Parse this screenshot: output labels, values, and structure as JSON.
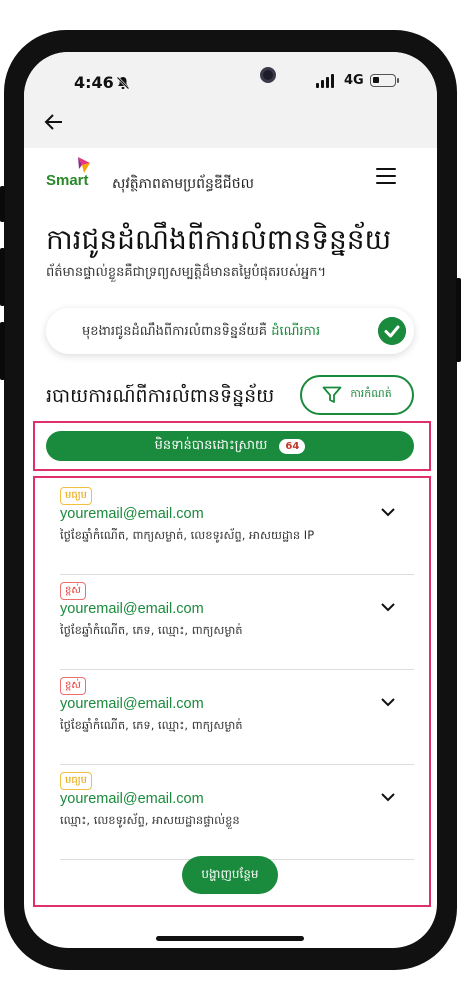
{
  "status_bar": {
    "time": "4:46",
    "network": "4G"
  },
  "header": {
    "logo_text": "Smart",
    "tagline": "សុវត្ថិភាពតាមប្រព័ន្ធឌីជីថល"
  },
  "page": {
    "title": "ការជូនដំណឹងពីការលំពានទិន្នន័យ",
    "subtitle": "ព័ត៌មានផ្ទាល់ខ្លួនគឺជាទ្រព្យសម្បត្តិដ៏មានតម្លៃបំផុតរបស់អ្នក។"
  },
  "status_card": {
    "text": "មុខងារជូនដំណឹងពីការលំពានទិន្នន័យគឺ",
    "status": "ដំណើរការ"
  },
  "breaches": {
    "title": "របាយការណ៍ពីការលំពានទិន្នន័យ",
    "filter_label": "ការកំណត់",
    "tab_label": "មិនទាន់បានដោះស្រាយ",
    "tab_count": "64",
    "items": [
      {
        "risk": "មធ្យម",
        "email": "youremail@email.com",
        "details": "ថ្ងៃខែឆ្នាំកំណើត, ពាក្យសម្ងាត់, លេខទូរស័ព្ទ, អាសយដ្ឋាន IP"
      },
      {
        "risk": "ខ្ពស់",
        "email": "youremail@email.com",
        "details": "ថ្ងៃខែឆ្នាំកំណើត, ភេទ, ឈ្មោះ, ពាក្យសម្ងាត់"
      },
      {
        "risk": "ខ្ពស់",
        "email": "youremail@email.com",
        "details": "ថ្ងៃខែឆ្នាំកំណើត, ភេទ, ឈ្មោះ, ពាក្យសម្ងាត់"
      },
      {
        "risk": "មធ្យម",
        "email": "youremail@email.com",
        "details": "ឈ្មោះ, លេខទូរស័ព្ទ, អាសយដ្ឋានផ្ទាល់ខ្លួន"
      }
    ],
    "show_more_label": "បង្ហាញបន្ថែម"
  },
  "colors": {
    "brand_green": "#1a8a3c",
    "highlight": "#e0306a",
    "risk_medium": "#e8a400",
    "risk_high": "#e53935"
  }
}
